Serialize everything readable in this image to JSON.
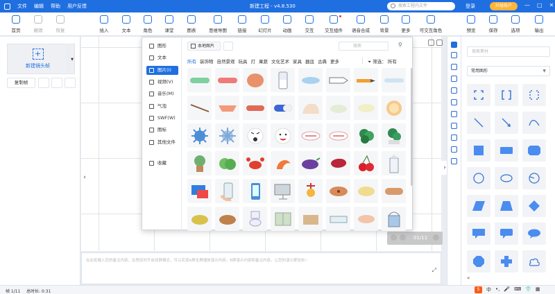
{
  "titlebar": {
    "menus": [
      "文件",
      "编辑",
      "帮助",
      "用户反馈"
    ],
    "title": "新建工程 - v4.8.530",
    "search_placeholder": "搜索工程内文件",
    "login": "登录",
    "upgrade": "升级账户",
    "window_buttons": [
      "—",
      "□",
      "✕"
    ]
  },
  "toolbar": {
    "items": [
      "首页",
      "撤销",
      "恢复",
      "插入",
      "文本",
      "角色",
      "课堂",
      "图表",
      "思维导图",
      "链接",
      "幻灯片",
      "动画",
      "交互",
      "交互组件",
      "语音合成",
      "背景",
      "更多",
      "可交互角色",
      "预览",
      "保存",
      "选项",
      "输出"
    ]
  },
  "left_panel": {
    "new_frame": "新建镜头帧",
    "copy_frame": "复制帧"
  },
  "asset_popup": {
    "categories": [
      "图形",
      "文本",
      "图片(I)",
      "视频(V)",
      "音乐(M)",
      "气泡",
      "SWF(W)",
      "图标",
      "其他文件",
      "收藏"
    ],
    "local_image": "本地图片",
    "search_placeholder": "搜索",
    "tags": [
      "所有",
      "装饰物",
      "自然景观",
      "玩具",
      "灯",
      "果蔬",
      "文化艺术",
      "家具",
      "器皿",
      "古典",
      "更多"
    ],
    "filter_label": "筛选：",
    "filter_value": "所有"
  },
  "canvas": {
    "page_indicator": "01/11"
  },
  "notes": {
    "placeholder": "在此处输入您的备注内容，在预览时开启双屏模式，可以实现A屏全屏播放演示内容，B屏演示内容和备注内容，让您的演示更轻松~"
  },
  "right_panel": {
    "search_placeholder": "搜索素材",
    "category": "常用图形"
  },
  "status": {
    "frame": "帧 1/11",
    "duration": "总时长: 0:31",
    "ime": "中"
  },
  "colors": {
    "accent": "#1f6fe0",
    "upgrade": "#ffb43a"
  }
}
